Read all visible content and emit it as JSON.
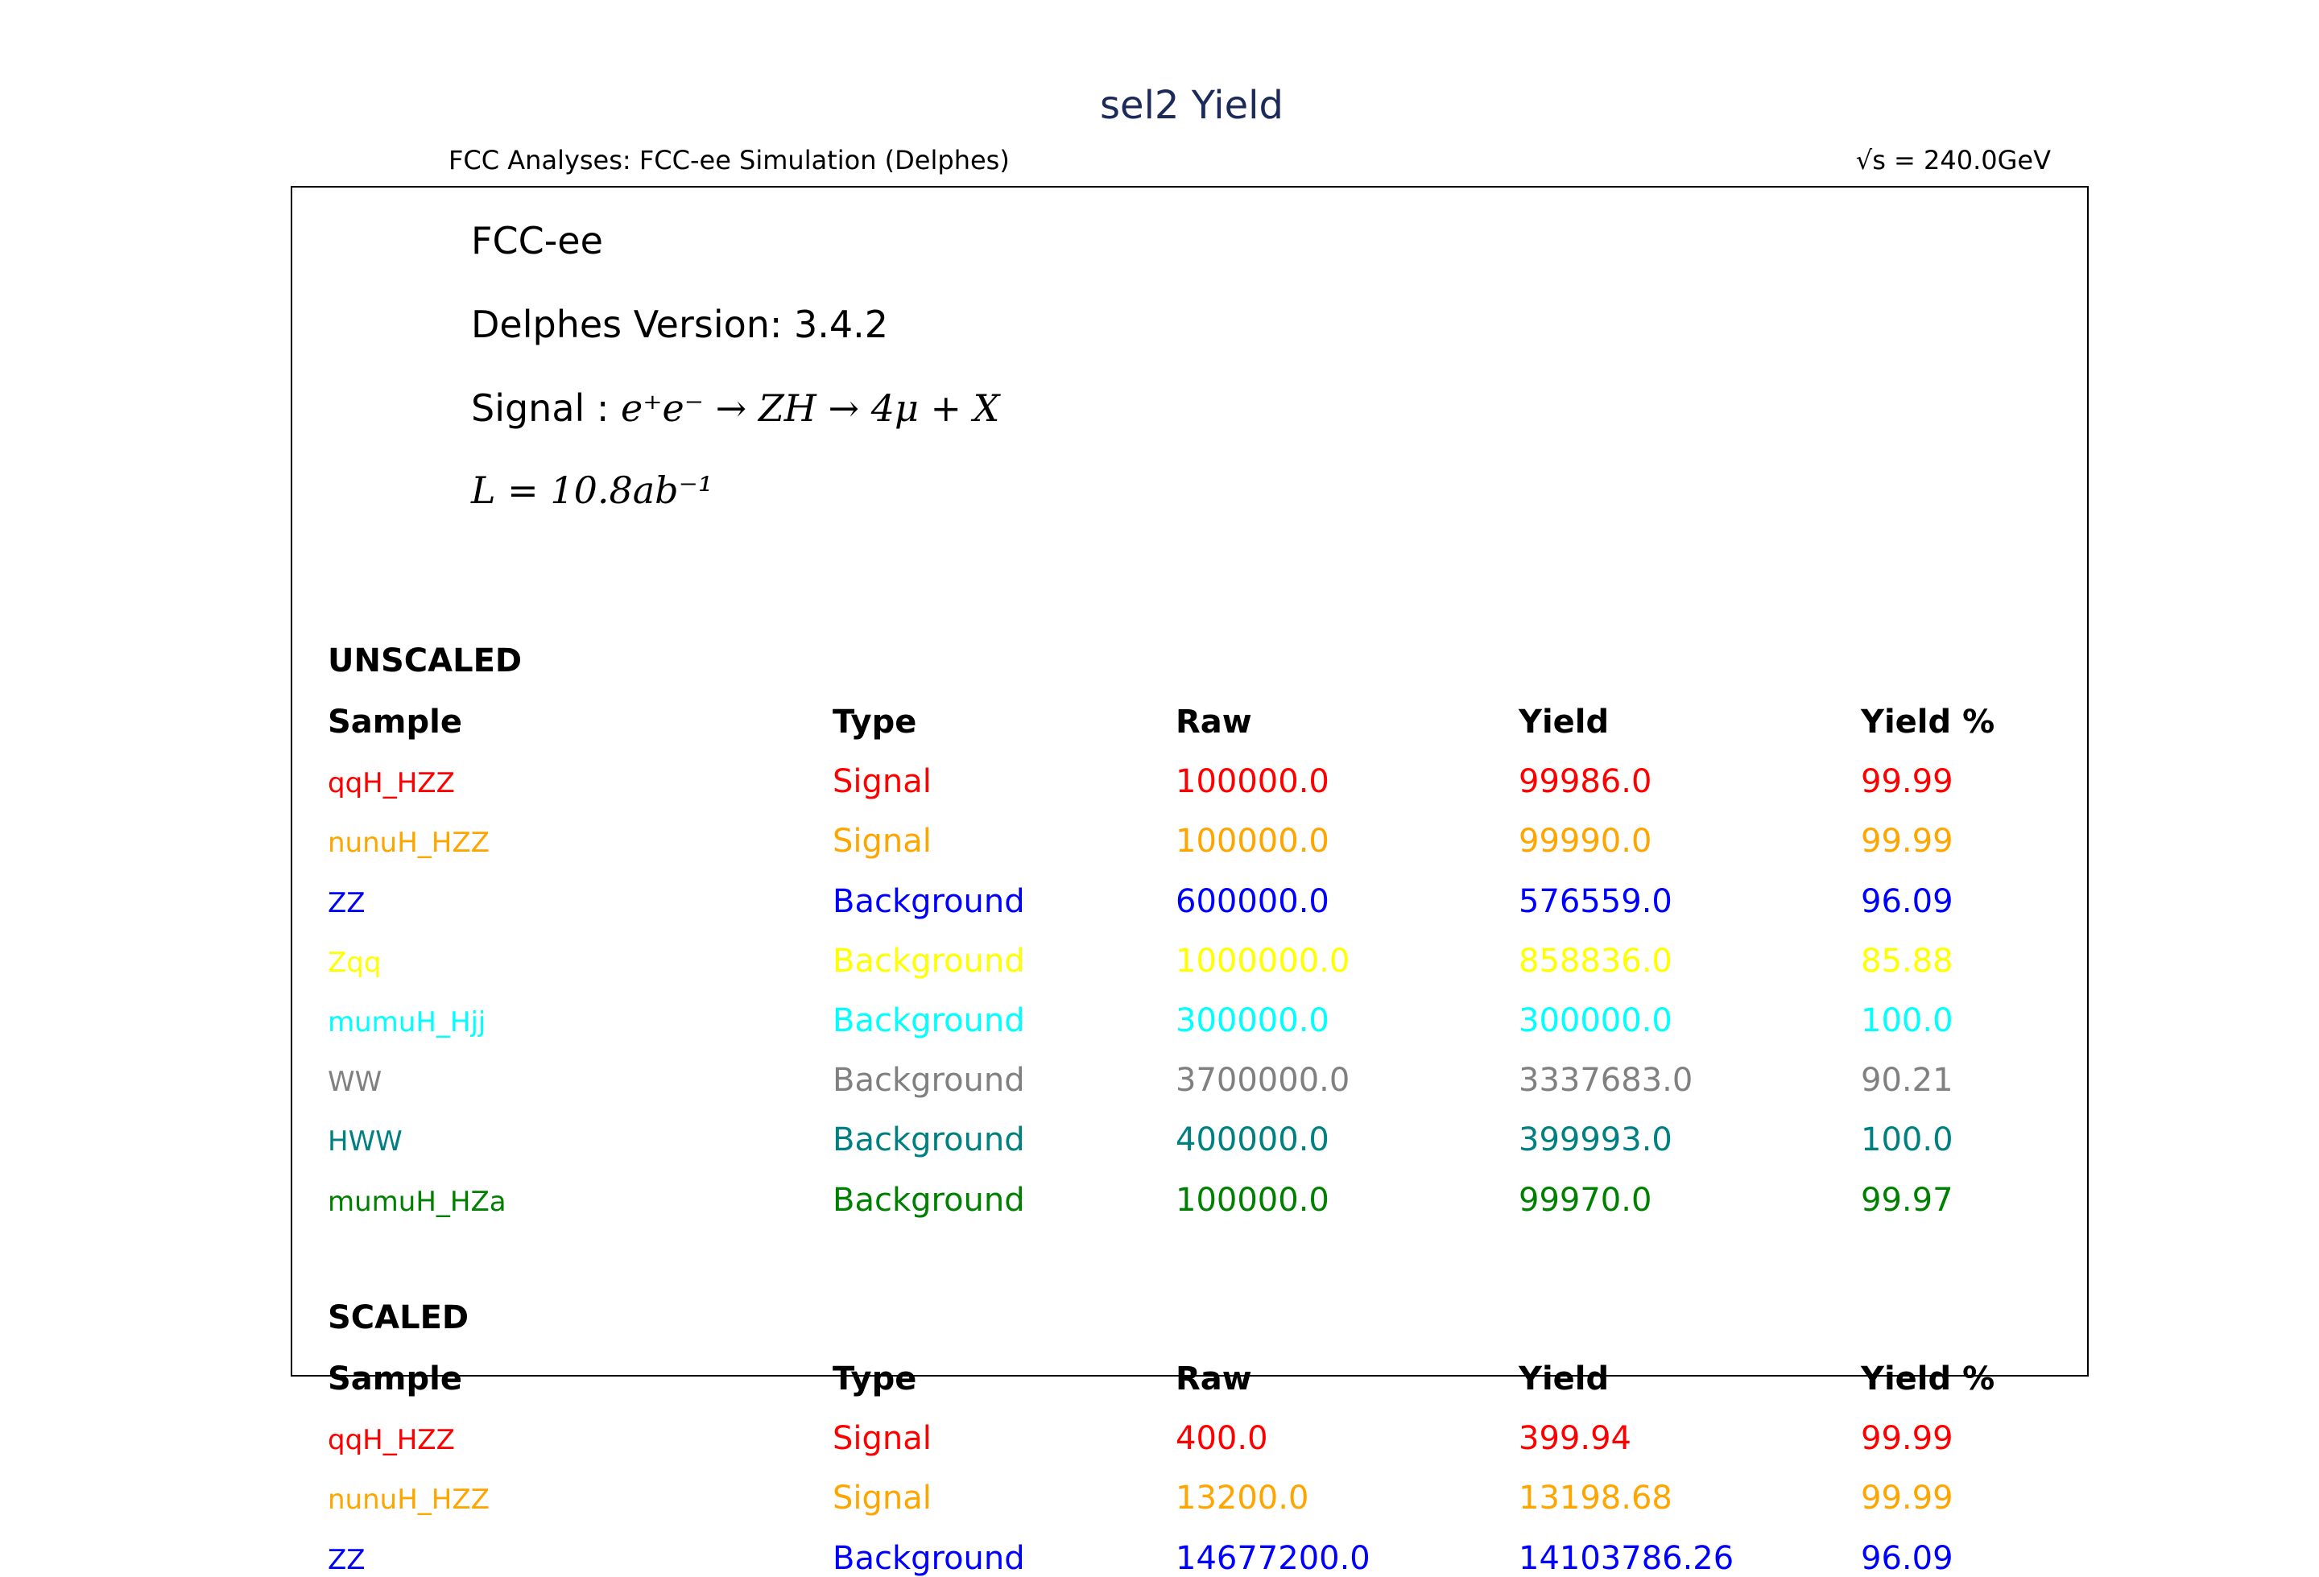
{
  "chart_data": {
    "type": "table",
    "title": "sel2 Yield",
    "subtitle_left": "FCC Analyses: FCC-ee Simulation (Delphes)",
    "subtitle_right": "√s = 240.0GeV",
    "info": {
      "collider": "FCC-ee",
      "delphes": "Delphes Version: 3.4.2",
      "signal_prefix": "Signal : ",
      "signal_process": "e⁺e⁻ → ZH → 4μ + X",
      "luminosity": "L = 10.8ab⁻¹"
    },
    "columns": [
      "Sample",
      "Type",
      "Raw",
      "Yield",
      "Yield %"
    ],
    "sections": [
      {
        "name": "UNSCALED",
        "rows": [
          {
            "sample": "qqH_HZZ",
            "type": "Signal",
            "raw": "100000.0",
            "yield": "99986.0",
            "pct": "99.99",
            "color": "#ff0000"
          },
          {
            "sample": "nunuH_HZZ",
            "type": "Signal",
            "raw": "100000.0",
            "yield": "99990.0",
            "pct": "99.99",
            "color": "#ffa500"
          },
          {
            "sample": "ZZ",
            "type": "Background",
            "raw": "600000.0",
            "yield": "576559.0",
            "pct": "96.09",
            "color": "#0000ff"
          },
          {
            "sample": "Zqq",
            "type": "Background",
            "raw": "1000000.0",
            "yield": "858836.0",
            "pct": "85.88",
            "color": "#ffff00"
          },
          {
            "sample": "mumuH_Hjj",
            "type": "Background",
            "raw": "300000.0",
            "yield": "300000.0",
            "pct": "100.0",
            "color": "#00ffff"
          },
          {
            "sample": "WW",
            "type": "Background",
            "raw": "3700000.0",
            "yield": "3337683.0",
            "pct": "90.21",
            "color": "#808080"
          },
          {
            "sample": "HWW",
            "type": "Background",
            "raw": "400000.0",
            "yield": "399993.0",
            "pct": "100.0",
            "color": "#008080"
          },
          {
            "sample": "mumuH_HZa",
            "type": "Background",
            "raw": "100000.0",
            "yield": "99970.0",
            "pct": "99.97",
            "color": "#008000"
          }
        ]
      },
      {
        "name": "SCALED",
        "rows": [
          {
            "sample": "qqH_HZZ",
            "type": "Signal",
            "raw": "400.0",
            "yield": "399.94",
            "pct": "99.99",
            "color": "#ff0000"
          },
          {
            "sample": "nunuH_HZZ",
            "type": "Signal",
            "raw": "13200.0",
            "yield": "13198.68",
            "pct": "99.99",
            "color": "#ffa500"
          },
          {
            "sample": "ZZ",
            "type": "Background",
            "raw": "14677200.0",
            "yield": "14103786.26",
            "pct": "96.09",
            "color": "#0000ff"
          }
        ]
      }
    ]
  }
}
